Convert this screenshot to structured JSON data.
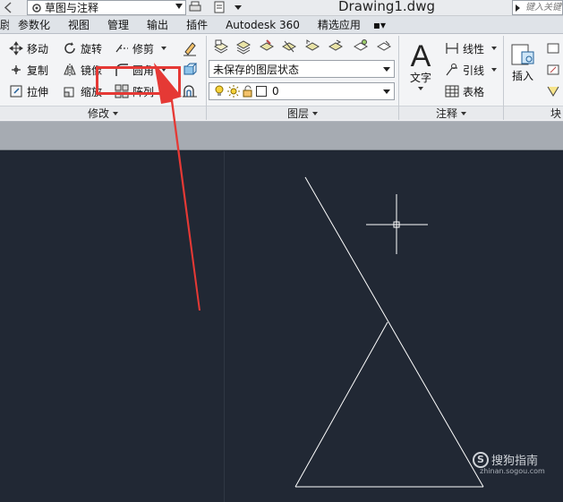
{
  "titlebar": {
    "workspace": "草图与注释",
    "document_title": "Drawing1.dwg",
    "search_placeholder": "键入关键"
  },
  "tabs": [
    "视图",
    "参数化",
    "管理",
    "输出",
    "插件",
    "Autodesk 360",
    "精选应用"
  ],
  "tab_first_partial": "尉",
  "modify_panel": {
    "title": "修改",
    "move": "移动",
    "rotate": "旋转",
    "trim": "修剪",
    "copy": "复制",
    "mirror": "镜像",
    "fillet": "圆角",
    "stretch": "拉伸",
    "scale": "缩放",
    "array": "阵列"
  },
  "layer_panel": {
    "title": "图层",
    "layer_state": "未保存的图层状态",
    "current_layer": "0"
  },
  "annotation_panel": {
    "title": "注释",
    "text": "文字",
    "linear": "线性",
    "leader": "引线",
    "table": "表格"
  },
  "block_panel": {
    "title": "块",
    "insert": "插入"
  },
  "watermark": {
    "brand": "搜狗指南",
    "url": "zhinan.sogou.com"
  },
  "colors": {
    "highlight": "#e53935",
    "canvas": "#212834",
    "geometry": "#ffffff",
    "arrow": "#e53935"
  }
}
